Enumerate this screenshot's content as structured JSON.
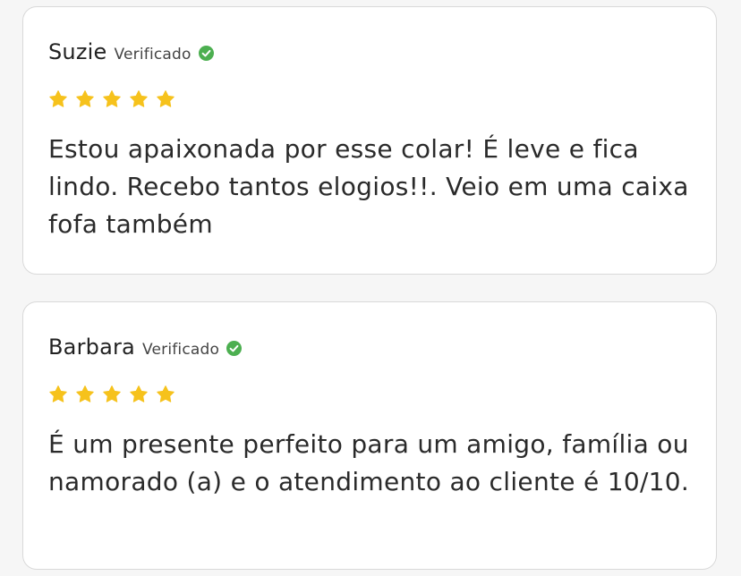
{
  "reviews": [
    {
      "name": "Suzie",
      "verified_label": "Verificado",
      "rating": 5,
      "text": "Estou apaixonada por esse colar! É leve e fica lindo. Recebo tantos elogios!!. Veio em uma caixa fofa também"
    },
    {
      "name": "Barbara",
      "verified_label": "Verificado",
      "rating": 5,
      "text": "É um presente perfeito para um amigo, família ou namorado (a) e o atendimento ao cliente é 10/10."
    }
  ],
  "icons": {
    "verified": "check-circle-icon",
    "star": "star-icon"
  },
  "colors": {
    "star": "#f6c21c",
    "verified": "#4caf50",
    "card_border": "#d9d9d9",
    "background": "#f6f6f6"
  }
}
